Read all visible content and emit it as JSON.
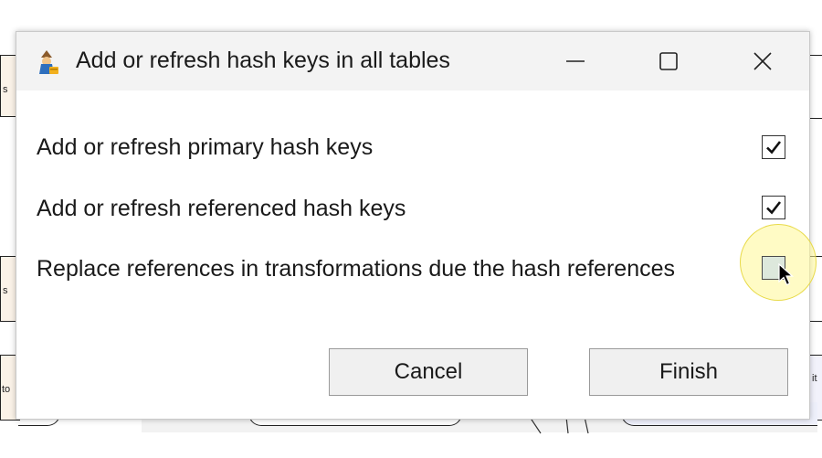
{
  "dialog": {
    "title": "Add or refresh hash keys in all tables",
    "icon": "wizard-app-icon",
    "window_controls": [
      "minimize-icon",
      "maximize-icon",
      "close-icon"
    ]
  },
  "options": [
    {
      "label": "Add or refresh primary hash keys",
      "checked": true
    },
    {
      "label": "Add or refresh referenced hash keys",
      "checked": true
    },
    {
      "label": "Replace references in transformations due the hash references",
      "checked": false
    }
  ],
  "buttons": {
    "cancel": "Cancel",
    "finish": "Finish"
  },
  "background": {
    "fragment_top": "s",
    "fragment_mid": "s",
    "fragment_bottom_left": "to",
    "fragment_bottom_right": "it"
  }
}
